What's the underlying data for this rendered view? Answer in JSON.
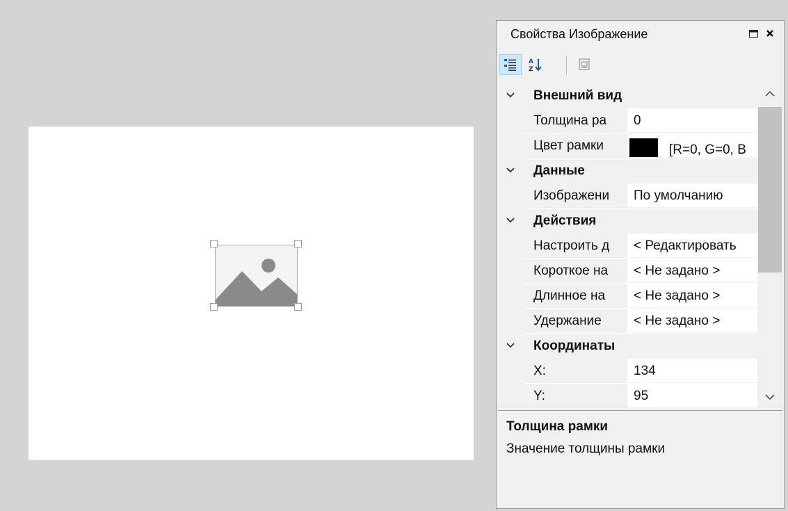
{
  "panel": {
    "title": "Свойства Изображение",
    "restore_icon": "window-restore-icon",
    "close_icon": "close-icon"
  },
  "toolbar": {
    "categorized_icon": "categorized-view-icon",
    "alphabetical_icon": "sort-alphabetical-icon",
    "property_pages_icon": "property-pages-icon"
  },
  "grid": {
    "appearance": {
      "label": "Внешний вид",
      "border_width_label": "Толщина ра",
      "border_width_value": "0",
      "border_color_label": "Цвет рамки",
      "border_color_value": "[R=0, G=0, B",
      "border_color_swatch": "#000000"
    },
    "data": {
      "label": "Данные",
      "image_label": "Изображени",
      "image_value": "По умолчанию"
    },
    "actions": {
      "label": "Действия",
      "configure_label": "Настроить д",
      "configure_value": "< Редактировать",
      "short_press_label": "Короткое на",
      "short_press_value": "< Не задано >",
      "long_press_label": "Длинное на",
      "long_press_value": "< Не задано >",
      "hold_label": "Удержание",
      "hold_value": "< Не задано >"
    },
    "coords": {
      "label": "Координаты",
      "x_label": "X:",
      "x_value": "134",
      "y_label": "Y:",
      "y_value": "95"
    }
  },
  "description": {
    "title": "Толщина рамки",
    "text": "Значение толщины рамки"
  },
  "colors": {
    "accent": "#cce8ff",
    "canvas": "#ffffff",
    "workspace": "#d4d4d4",
    "image_placeholder": "#8a8a8a"
  },
  "canvas": {
    "image_icon": "image-placeholder-icon"
  }
}
